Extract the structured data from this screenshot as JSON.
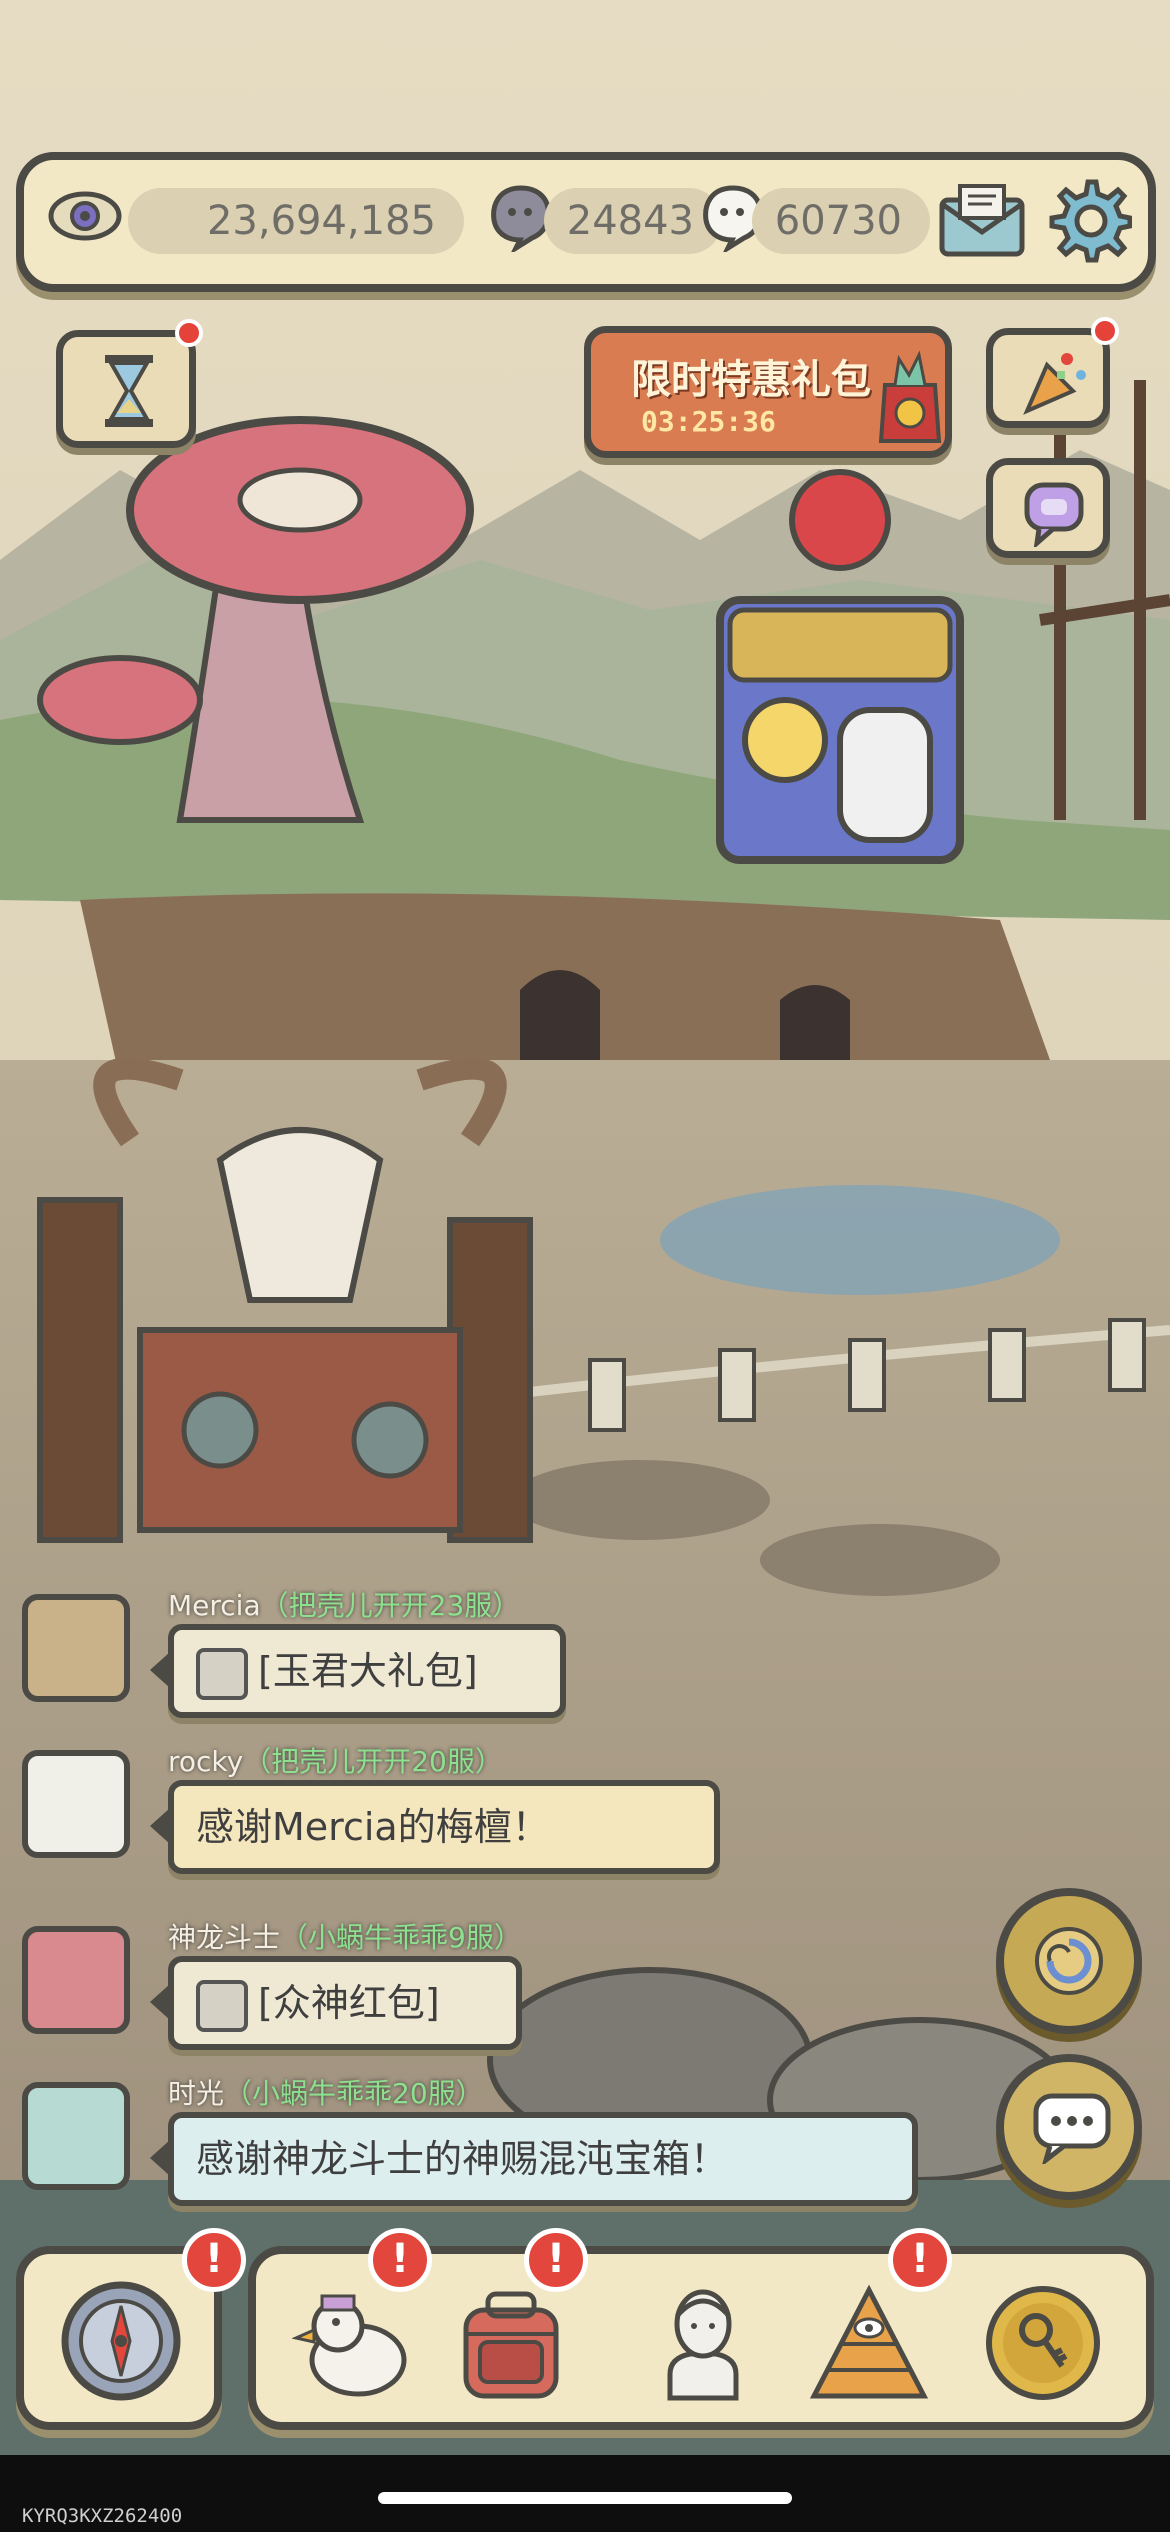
{
  "resources": {
    "eye_value": "23,694,185",
    "gray_bubble_value": "24843",
    "white_bubble_value": "60730"
  },
  "promo": {
    "title": "限时特惠礼包",
    "timer": "03:25:36"
  },
  "chat": [
    {
      "user": "Mercia",
      "server": "（把壳儿开开23服）",
      "message": "[玉君大礼包]",
      "type": "gift"
    },
    {
      "user": "rocky",
      "server": "（把壳儿开开20服）",
      "message": "感谢Mercia的梅檀！",
      "type": "text"
    },
    {
      "user": "神龙斗士",
      "server": "（小蜗牛乖乖9服）",
      "message": "[众神红包]",
      "type": "gift"
    },
    {
      "user": "时光",
      "server": "（小蜗牛乖乖20服）",
      "message": "感谢神龙斗士的神赐混沌宝箱！",
      "type": "text"
    }
  ],
  "alerts": {
    "compass": "!",
    "duck": "!",
    "backpack": "!",
    "pyramid": "!"
  },
  "watermark": "KYRQ3KXZ262400",
  "colors": {
    "frame": "#4b4a45",
    "panel": "#f3e8c6",
    "alert": "#e3463c",
    "server_green": "#8de08d"
  },
  "icons": [
    "eye-icon",
    "gray-bubble-icon",
    "white-bubble-icon",
    "mail-icon",
    "gear-icon",
    "hourglass-icon",
    "gift-bag-icon",
    "party-popper-icon",
    "chat-bubble-icon",
    "compass-icon",
    "duck-icon",
    "backpack-icon",
    "statue-icon",
    "pyramid-eye-icon",
    "key-coin-icon",
    "swirl-icon",
    "speech-icon"
  ]
}
